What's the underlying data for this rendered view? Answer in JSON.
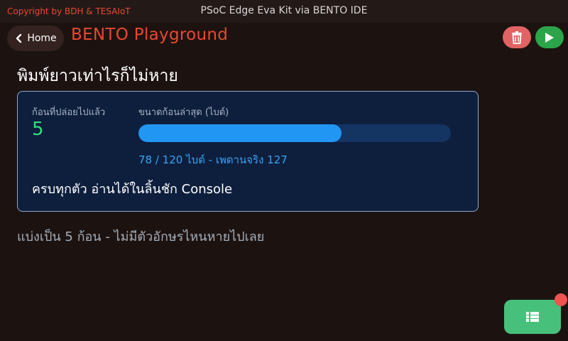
{
  "topbar": {
    "copyright": "Copyright by BDH & TESAIoT",
    "app_title": "PSoC Edge Eva Kit via BENTO IDE"
  },
  "header": {
    "home_label": "Home",
    "home_icon": "chevron-left-icon",
    "page_title": "BENTO Playground",
    "delete_icon": "trash-icon",
    "run_icon": "play-icon",
    "colors": {
      "accent": "#e8492e",
      "delete": "#e26363",
      "run": "#2ba44a"
    }
  },
  "main": {
    "heading": "พิมพ์ยาวเท่าไรก็ไม่หาย",
    "card": {
      "sent_label": "ก้อนที่ปล่อยไปแล้ว",
      "sent_value": "5",
      "size_label": "ขนาดก้อนล่าสุด (ไบต์)",
      "progress_fraction": 0.65,
      "size_detail": "78 / 120 ไบต์ - เพดานจริง 127",
      "status": "ครบทุกตัว อ่านได้ในลิ้นชัก Console"
    },
    "footnote": "แบ่งเป็น 5 ก้อน - ไม่มีตัวอักษรไหนหายไปเลย"
  },
  "fab": {
    "icon": "list-icon",
    "badge_color": "#ef5350",
    "color": "#46c07a"
  }
}
